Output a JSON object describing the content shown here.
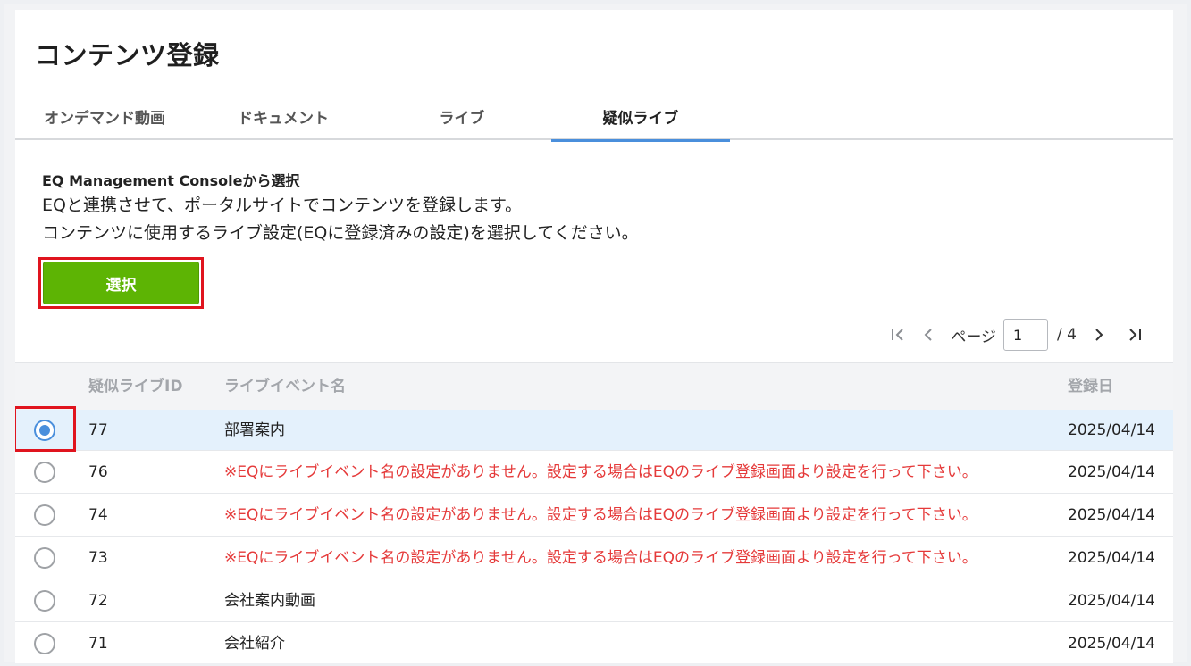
{
  "page": {
    "title": "コンテンツ登録"
  },
  "tabs": [
    {
      "label": "オンデマンド動画"
    },
    {
      "label": "ドキュメント"
    },
    {
      "label": "ライブ"
    },
    {
      "label": "疑似ライブ",
      "active": true
    }
  ],
  "description": {
    "heading": "EQ Management Consoleから選択",
    "line1": "EQと連携させて、ポータルサイトでコンテンツを登録します。",
    "line2": "コンテンツに使用するライブ設定(EQに登録済みの設定)を選択してください。"
  },
  "select_button": {
    "label": "選択"
  },
  "pager": {
    "label": "ページ",
    "current": "1",
    "total": "/ 4",
    "icons": [
      "first-page-icon",
      "prev-page-icon",
      "next-page-icon",
      "last-page-icon"
    ]
  },
  "table": {
    "headers": {
      "id": "疑似ライブID",
      "name": "ライブイベント名",
      "date": "登録日"
    },
    "rows": [
      {
        "id": "77",
        "name": "部署案内",
        "date": "2025/04/14",
        "selected": true,
        "warning": false
      },
      {
        "id": "76",
        "name": "※EQにライブイベント名の設定がありません。設定する場合はEQのライブ登録画面より設定を行って下さい。",
        "date": "2025/04/14",
        "selected": false,
        "warning": true
      },
      {
        "id": "74",
        "name": "※EQにライブイベント名の設定がありません。設定する場合はEQのライブ登録画面より設定を行って下さい。",
        "date": "2025/04/14",
        "selected": false,
        "warning": true
      },
      {
        "id": "73",
        "name": "※EQにライブイベント名の設定がありません。設定する場合はEQのライブ登録画面より設定を行って下さい。",
        "date": "2025/04/14",
        "selected": false,
        "warning": true
      },
      {
        "id": "72",
        "name": "会社案内動画",
        "date": "2025/04/14",
        "selected": false,
        "warning": false
      },
      {
        "id": "71",
        "name": "会社紹介",
        "date": "2025/04/14",
        "selected": false,
        "warning": false
      }
    ]
  },
  "colors": {
    "accent": "#4a8fdc",
    "button_green": "#5db404",
    "warning_red": "#e53a3a",
    "highlight_border": "#e0141e",
    "selected_row_bg": "#e4f1fc"
  }
}
